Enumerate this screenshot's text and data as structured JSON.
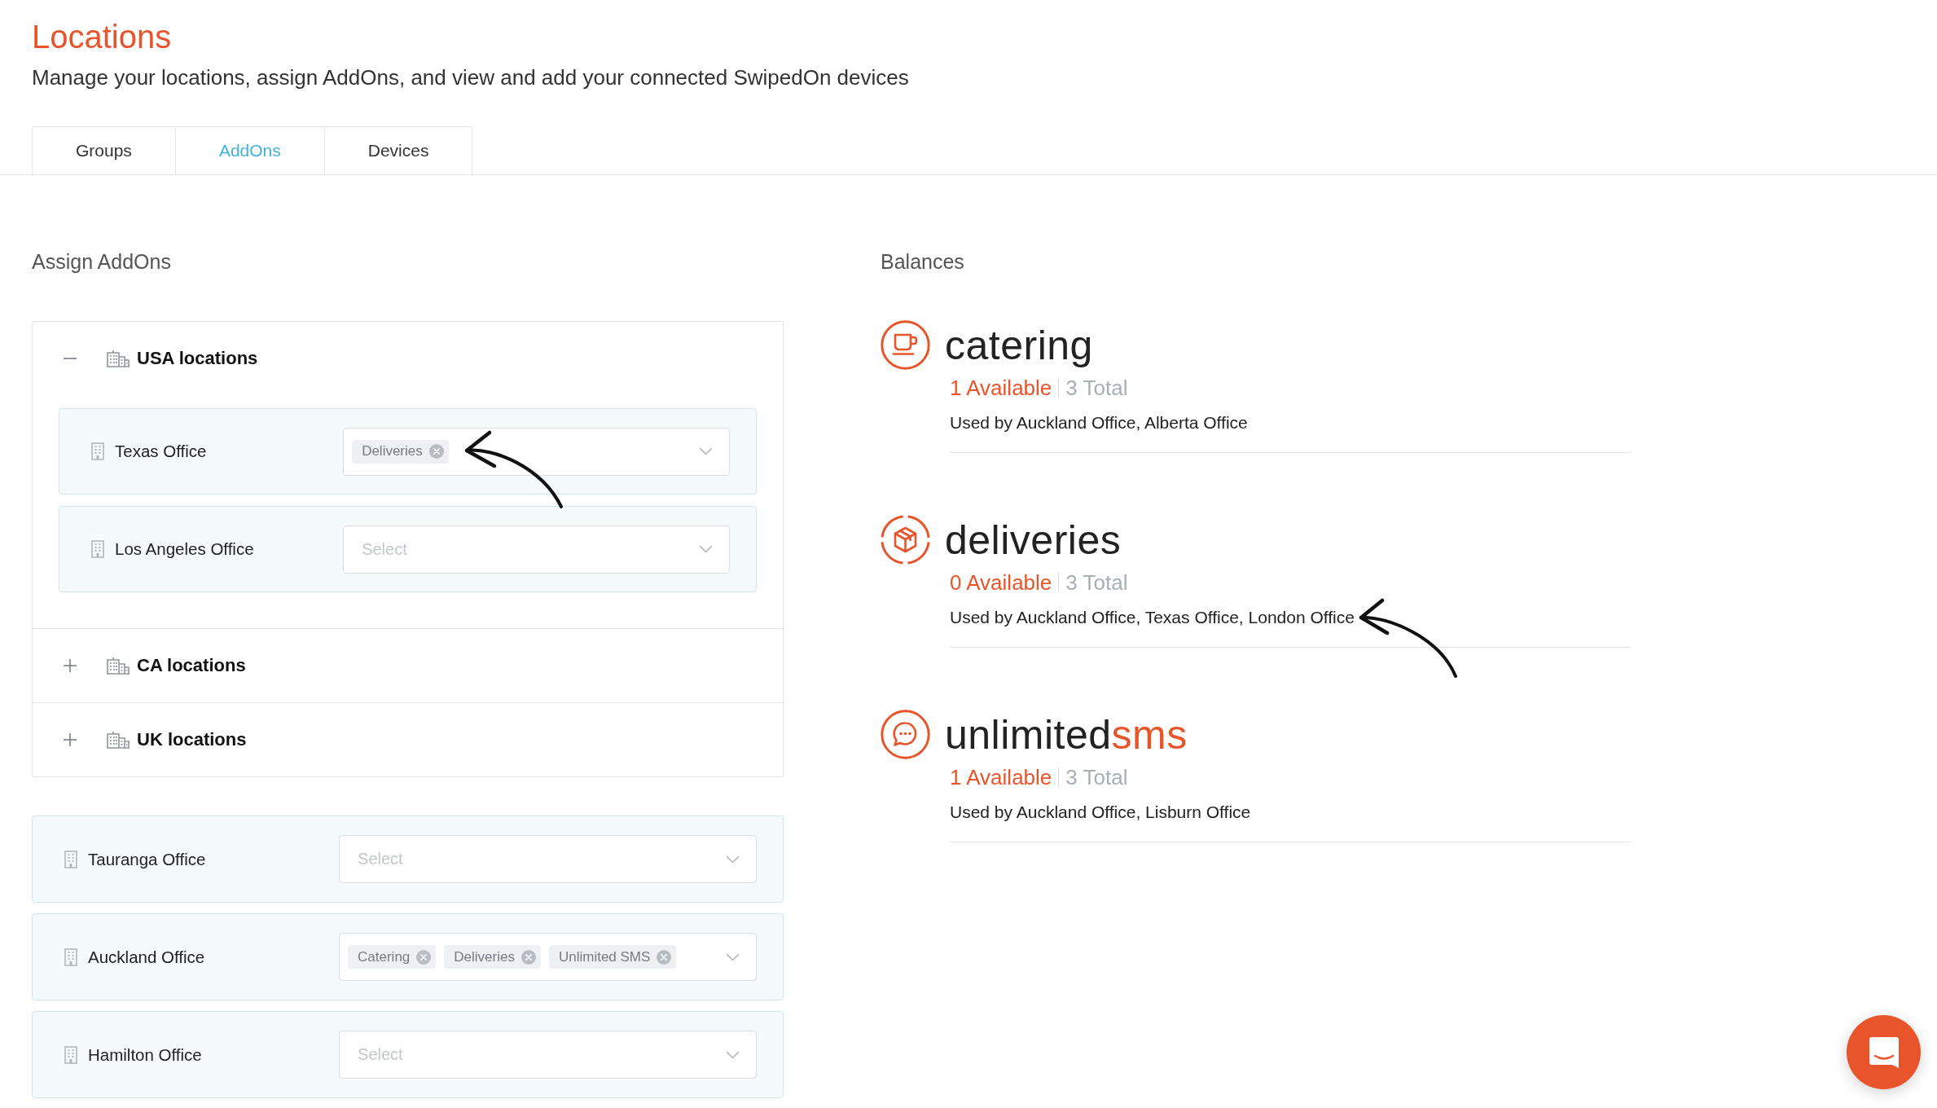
{
  "header": {
    "title": "Locations",
    "subtitle": "Manage your locations, assign AddOns, and view and add your connected SwipedOn devices"
  },
  "tabs": [
    {
      "label": "Groups",
      "selected": false
    },
    {
      "label": "AddOns",
      "selected": true
    },
    {
      "label": "Devices",
      "selected": false
    }
  ],
  "assign_addons": {
    "heading": "Assign AddOns",
    "groups": [
      {
        "label": "USA locations",
        "expanded": true,
        "offices": [
          {
            "name": "Texas Office",
            "addons": [
              "Deliveries"
            ]
          },
          {
            "name": "Los Angeles Office",
            "placeholder": "Select"
          }
        ]
      },
      {
        "label": "CA locations",
        "expanded": false
      },
      {
        "label": "UK locations",
        "expanded": false
      }
    ],
    "offices": [
      {
        "name": "Tauranga Office",
        "placeholder": "Select"
      },
      {
        "name": "Auckland Office",
        "addons": [
          "Catering",
          "Deliveries",
          "Unlimited SMS"
        ]
      },
      {
        "name": "Hamilton Office",
        "placeholder": "Select"
      }
    ]
  },
  "balances": {
    "heading": "Balances",
    "items": [
      {
        "kind": "catering",
        "logo": [
          {
            "text": "catering",
            "accent": false
          }
        ],
        "available": "1 Available",
        "total": "3 Total",
        "used_by": "Used by Auckland Office, Alberta Office"
      },
      {
        "kind": "deliveries",
        "logo": [
          {
            "text": "deliveries",
            "accent": false
          }
        ],
        "available": "0 Available",
        "total": "3 Total",
        "used_by": "Used by Auckland Office, Texas Office, London Office"
      },
      {
        "kind": "sms",
        "logo": [
          {
            "text": "unlimited",
            "accent": false
          },
          {
            "text": "sms",
            "accent": true
          }
        ],
        "available": "1 Available",
        "total": "3 Total",
        "used_by": "Used by Auckland Office, Lisburn Office"
      }
    ]
  }
}
